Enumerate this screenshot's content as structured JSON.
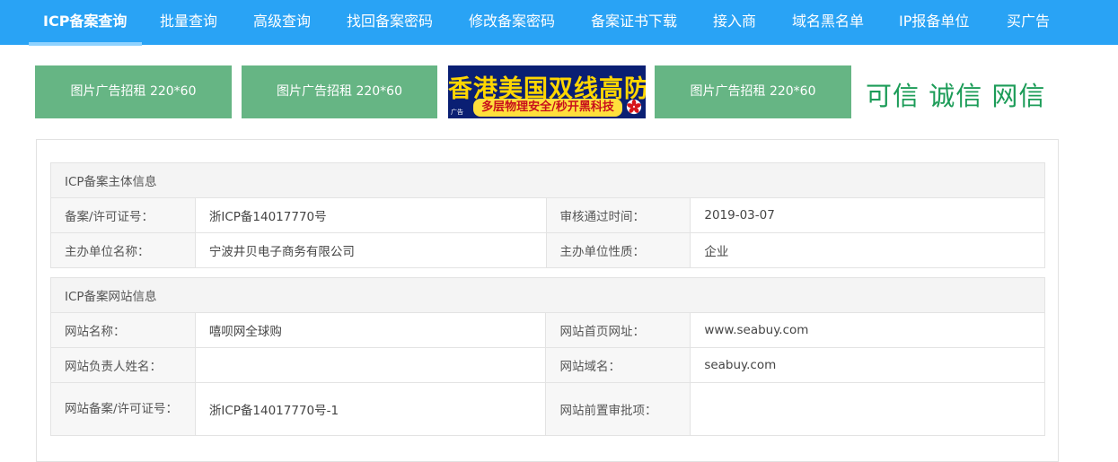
{
  "nav": {
    "items": [
      {
        "label": "ICP备案查询",
        "active": true
      },
      {
        "label": "批量查询"
      },
      {
        "label": "高级查询"
      },
      {
        "label": "找回备案密码"
      },
      {
        "label": "修改备案密码"
      },
      {
        "label": "备案证书下载"
      },
      {
        "label": "接入商"
      },
      {
        "label": "域名黑名单"
      },
      {
        "label": "IP报备单位"
      },
      {
        "label": "买广告"
      }
    ]
  },
  "ads": {
    "slot1": "图片广告招租 220*60",
    "slot2": "图片广告招租 220*60",
    "image_ad": {
      "line1": "香港美国双线高防",
      "line2": "多层物理安全/秒开黑科技",
      "small": "广告"
    },
    "slot4": "图片广告招租 220*60",
    "trust_text": "可信  诚信 网信"
  },
  "subject": {
    "heading": "ICP备案主体信息",
    "license_label": "备案/许可证号：",
    "license_value": "浙ICP备14017770号",
    "approved_label": "审核通过时间：",
    "approved_value": "2019-03-07",
    "org_label": "主办单位名称：",
    "org_value": "宁波井贝电子商务有限公司",
    "nature_label": "主办单位性质：",
    "nature_value": "企业"
  },
  "website": {
    "heading": "ICP备案网站信息",
    "name_label": "网站名称：",
    "name_value": "嘻呗网全球购",
    "homepage_label": "网站首页网址：",
    "homepage_value": "www.seabuy.com",
    "owner_label": "网站负责人姓名：",
    "owner_value": "",
    "domain_label": "网站域名：",
    "domain_value": "seabuy.com",
    "license_label": "网站备案/许可证号：",
    "license_value": "浙ICP备14017770号-1",
    "preapproval_label": "网站前置审批项：",
    "preapproval_value": ""
  },
  "colors": {
    "nav_bg": "#29a3f5",
    "ad_green": "#66b584",
    "trust_green": "#1c9c58"
  }
}
